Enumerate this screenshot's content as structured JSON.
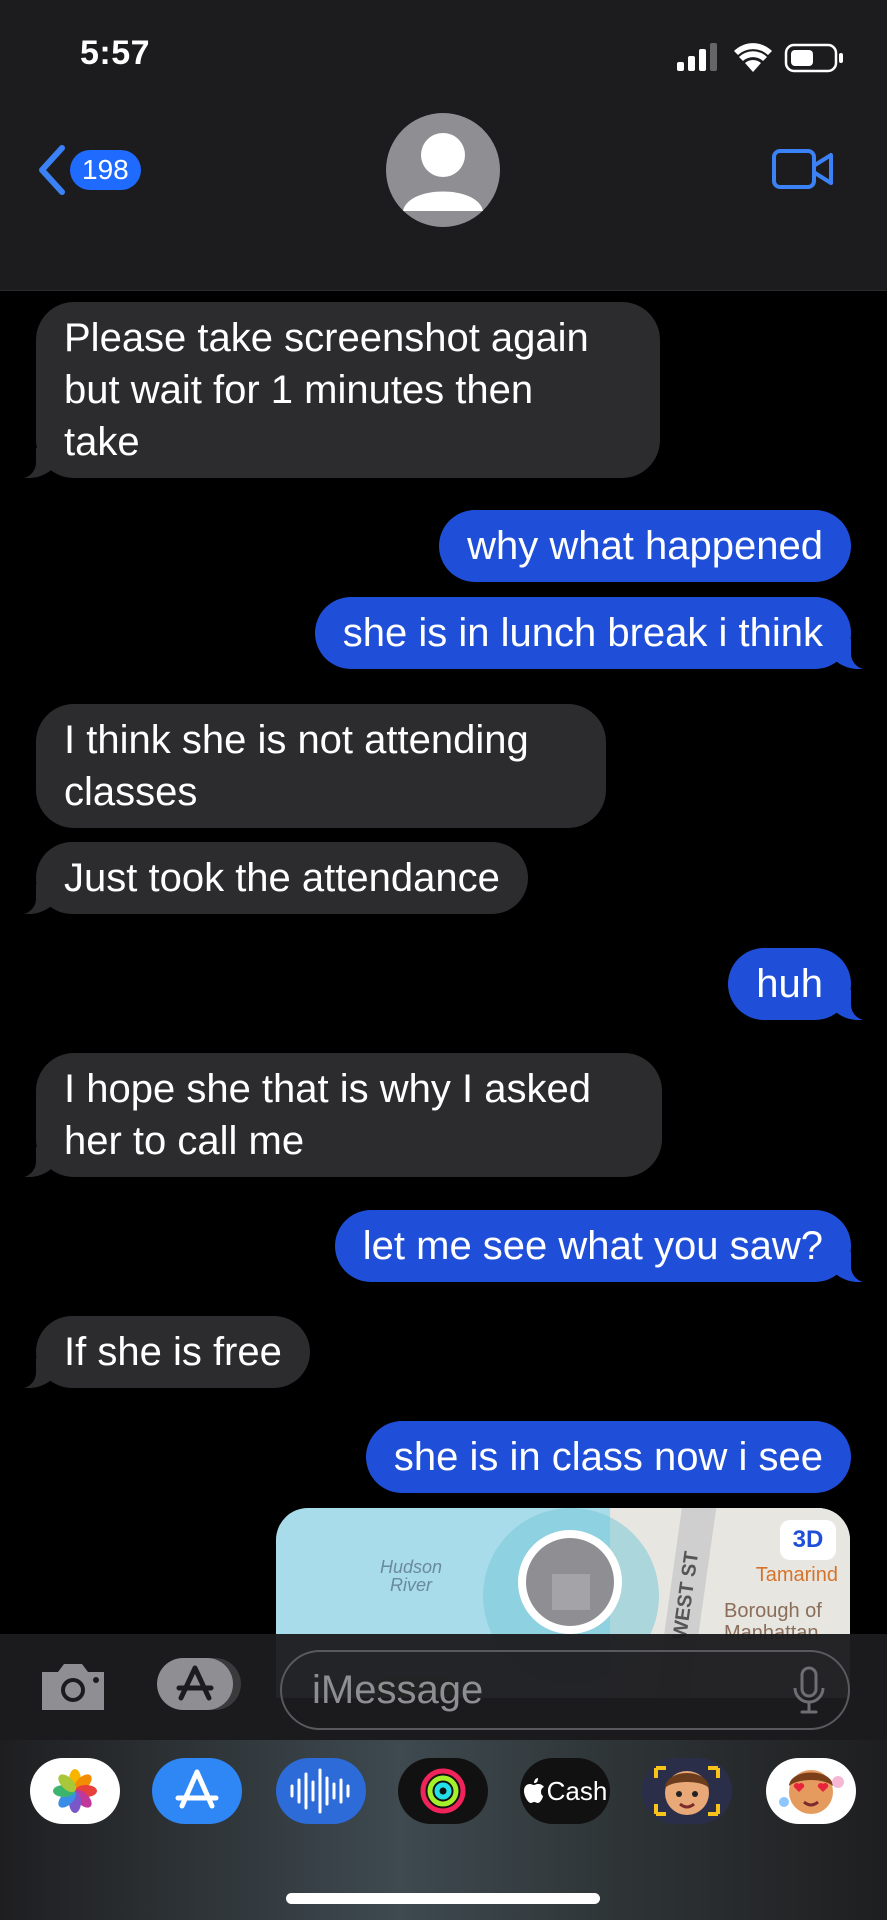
{
  "status_bar": {
    "time": "5:57"
  },
  "header": {
    "back_count": "198"
  },
  "messages": [
    {
      "from": "them",
      "text": "Please take screenshot again\nbut wait for 1 minutes then\ntake"
    },
    {
      "from": "me",
      "text": "why what happened"
    },
    {
      "from": "me",
      "text": "she is in lunch break i think"
    },
    {
      "from": "them",
      "text": "I think she is not attending\nclasses"
    },
    {
      "from": "them",
      "text": "Just took the attendance"
    },
    {
      "from": "me",
      "text": "huh"
    },
    {
      "from": "them",
      "text": "I hope she that is why I asked\nher to call me"
    },
    {
      "from": "me",
      "text": "let me see what you saw?"
    },
    {
      "from": "them",
      "text": "If she is free"
    },
    {
      "from": "me",
      "text": "she is in class now i see"
    }
  ],
  "map_preview": {
    "badge": "3D",
    "river_label": "Hudson\nRiver",
    "street_label": "WEST ST",
    "poi_1": "Tamarind",
    "poi_2": "Borough of\nManhattan"
  },
  "input_bar": {
    "placeholder": "iMessage"
  },
  "app_drawer": {
    "cash_label": "Cash",
    "apps": [
      "photos-icon",
      "app-store-icon",
      "audio-message-icon",
      "activity-icon",
      "apple-cash-icon",
      "memoji-icon",
      "memoji-stickers-icon"
    ]
  },
  "colors": {
    "outgoing": "#1f4fd9",
    "incoming": "#2c2c2e",
    "accent": "#3b82f6"
  }
}
